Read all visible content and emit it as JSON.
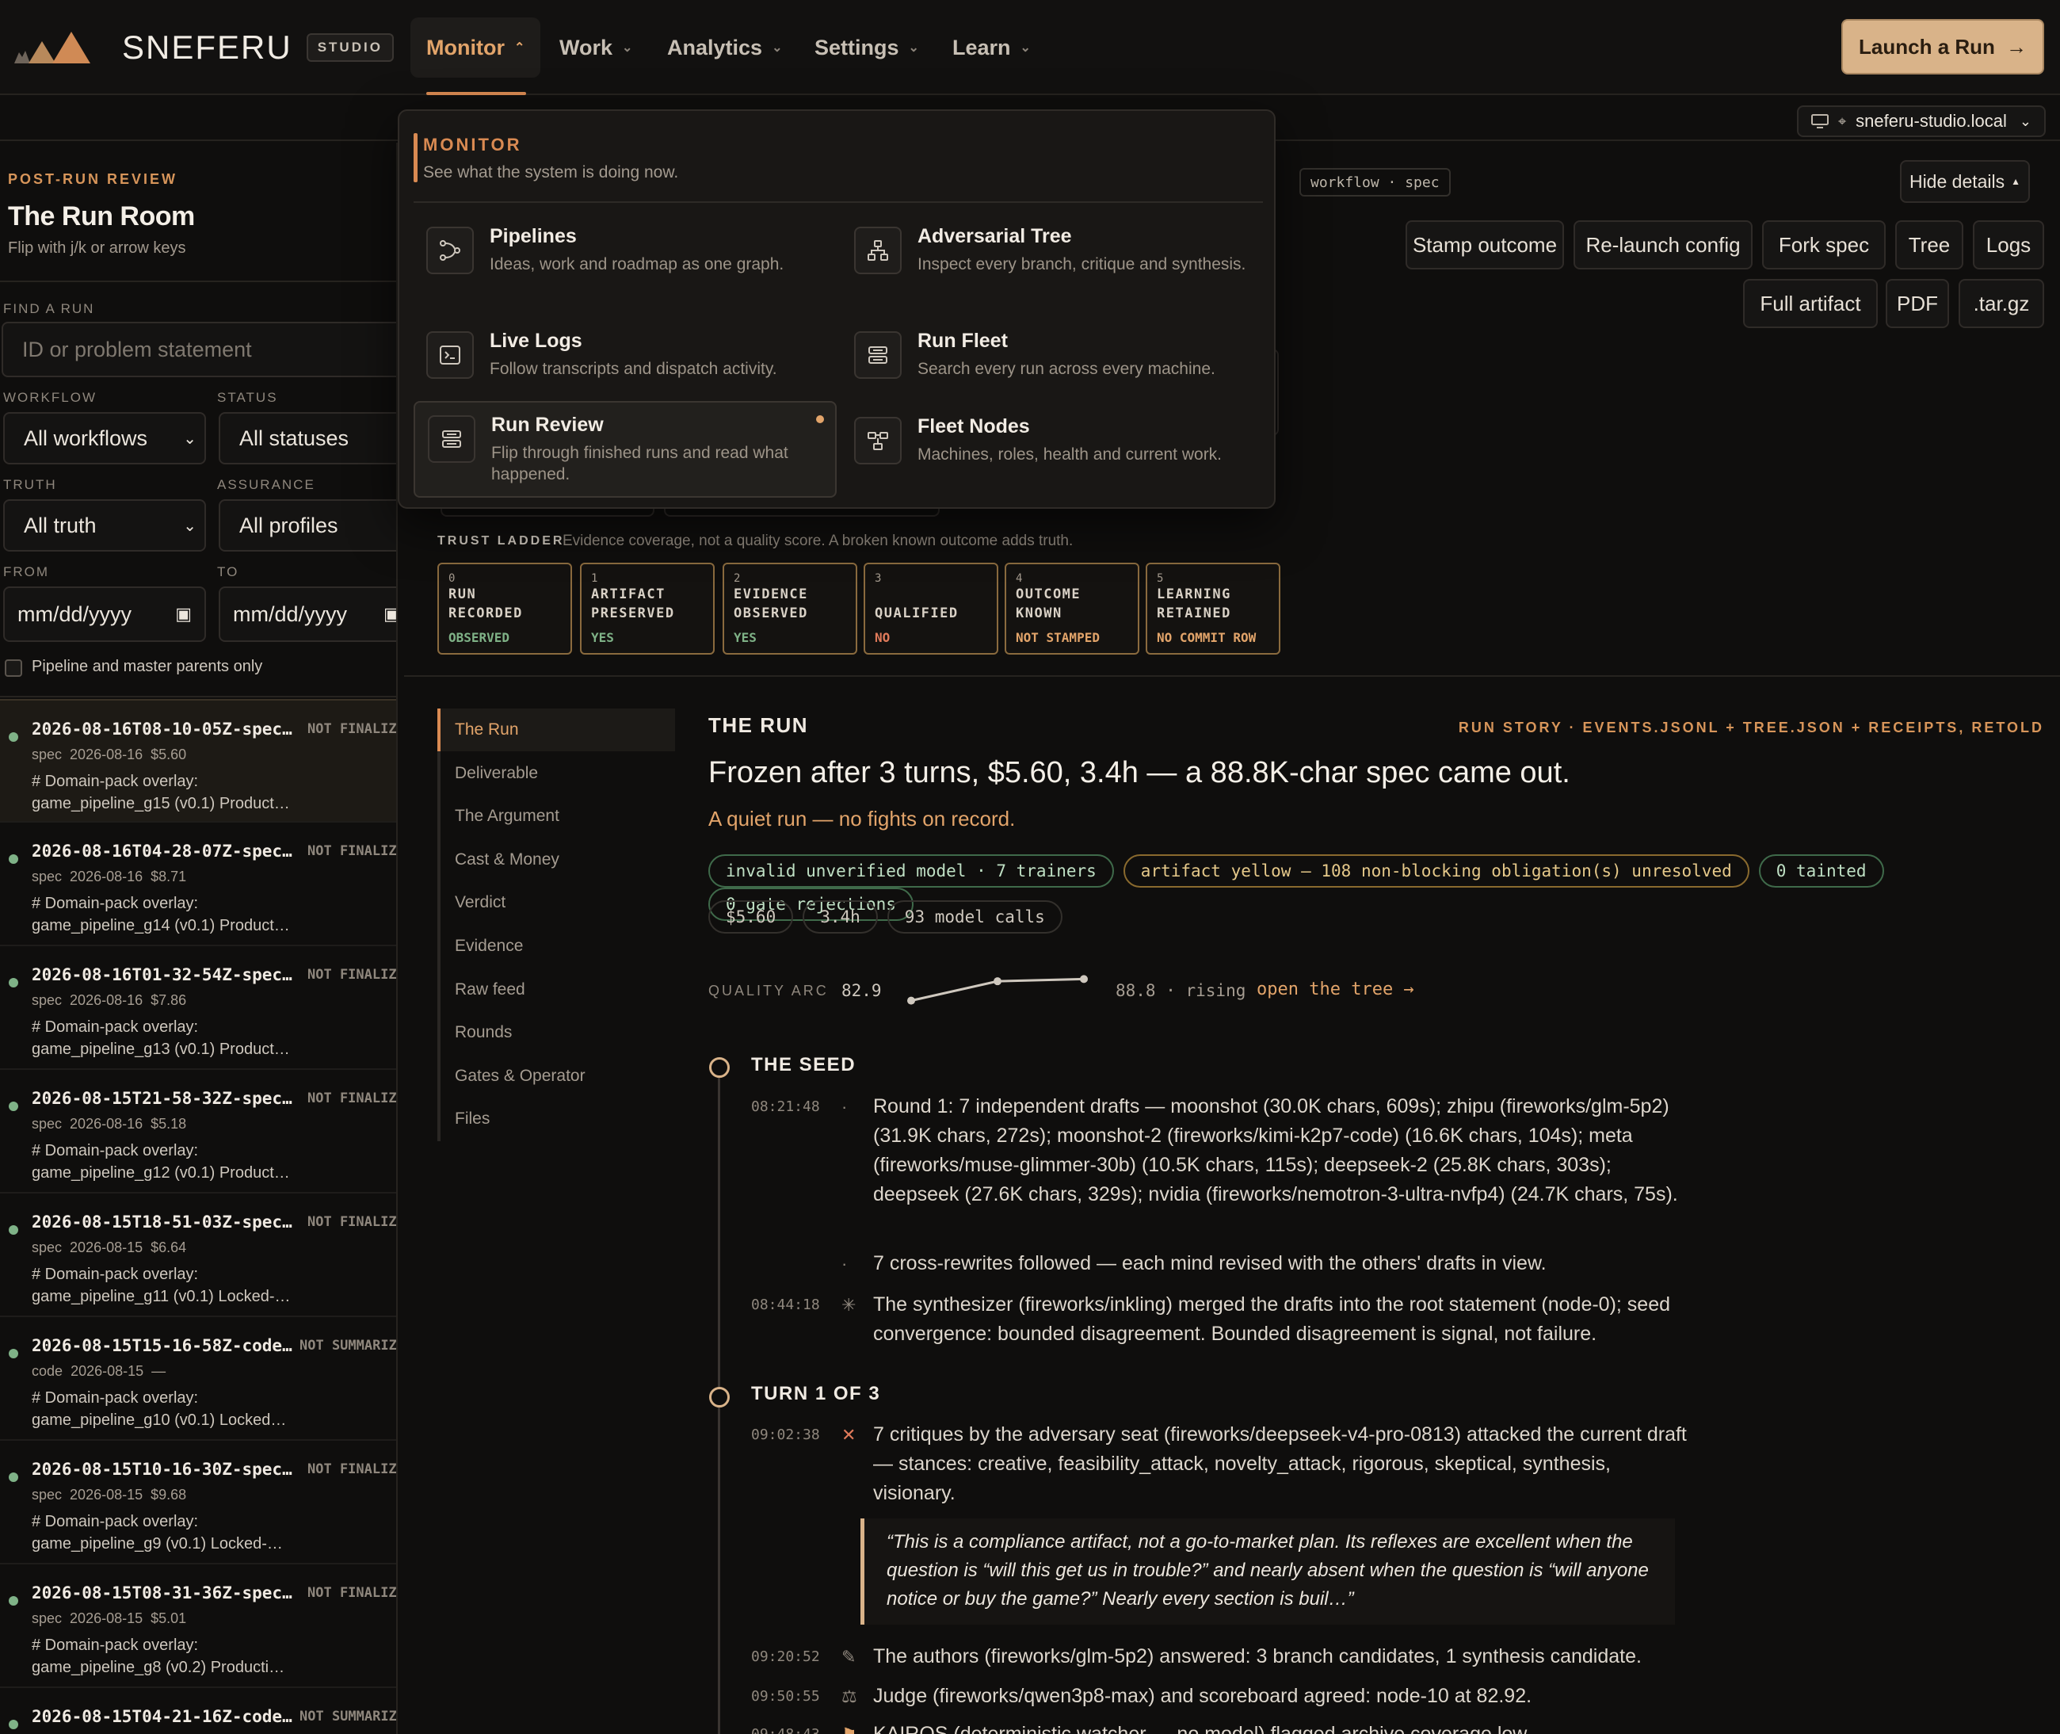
{
  "header": {
    "brand": "SNEFERU",
    "brand_badge": "STUDIO",
    "nav": [
      {
        "label": "Monitor"
      },
      {
        "label": "Work"
      },
      {
        "label": "Analytics"
      },
      {
        "label": "Settings"
      },
      {
        "label": "Learn"
      }
    ],
    "launch_label": "Launch a Run",
    "host": "sneferu-studio.local"
  },
  "sidebar": {
    "eyebrow": "POST-RUN REVIEW",
    "title": "The Run Room",
    "hint": "Flip with j/k or arrow keys",
    "find_label": "FIND A RUN",
    "find_placeholder": "ID or problem statement",
    "workflow_label": "WORKFLOW",
    "workflow_value": "All workflows",
    "status_label": "STATUS",
    "status_value": "All statuses",
    "truth_label": "TRUTH",
    "truth_value": "All truth",
    "assurance_label": "ASSURANCE",
    "assurance_value": "All profiles",
    "from_label": "FROM",
    "from_placeholder": "mm/dd/yyyy",
    "to_label": "TO",
    "to_placeholder": "mm/dd/yyyy",
    "parents_only": "Pipeline and master parents only",
    "runs": [
      {
        "title": "2026-08-16T08-10-05Z-spec-1…",
        "status": "NOT FINALIZ",
        "kind": "spec",
        "date": "2026-08-16",
        "cost": "$5.60",
        "overlay": "# Domain-pack overlay:",
        "overlay2": "game_pipeline_g15 (v0.1) Producti…"
      },
      {
        "title": "2026-08-16T04-28-07Z-spec-a…",
        "status": "NOT FINALIZ",
        "kind": "spec",
        "date": "2026-08-16",
        "cost": "$8.71",
        "overlay": "# Domain-pack overlay:",
        "overlay2": "game_pipeline_g14 (v0.1) Producti…"
      },
      {
        "title": "2026-08-16T01-32-54Z-spec-b…",
        "status": "NOT FINALIZ",
        "kind": "spec",
        "date": "2026-08-16",
        "cost": "$7.86",
        "overlay": "# Domain-pack overlay:",
        "overlay2": "game_pipeline_g13 (v0.1) Producti…"
      },
      {
        "title": "2026-08-15T21-58-32Z-spec-3…",
        "status": "NOT FINALIZ",
        "kind": "spec",
        "date": "2026-08-16",
        "cost": "$5.18",
        "overlay": "# Domain-pack overlay:",
        "overlay2": "game_pipeline_g12 (v0.1) Producti…"
      },
      {
        "title": "2026-08-15T18-51-03Z-spec-f…",
        "status": "NOT FINALIZ",
        "kind": "spec",
        "date": "2026-08-15",
        "cost": "$6.64",
        "overlay": "# Domain-pack overlay:",
        "overlay2": "game_pipeline_g11 (v0.1) Locked-…"
      },
      {
        "title": "2026-08-15T15-16-58Z-code-…",
        "status": "NOT SUMMARIZ",
        "kind": "code",
        "date": "2026-08-15",
        "cost": "—",
        "overlay": "# Domain-pack overlay:",
        "overlay2": "game_pipeline_g10 (v0.1) Locked…"
      },
      {
        "title": "2026-08-15T10-16-30Z-spec-4…",
        "status": "NOT FINALIZ",
        "kind": "spec",
        "date": "2026-08-15",
        "cost": "$9.68",
        "overlay": "# Domain-pack overlay:",
        "overlay2": "game_pipeline_g9 (v0.1) Locked-…"
      },
      {
        "title": "2026-08-15T08-31-36Z-spec-7…",
        "status": "NOT FINALIZ",
        "kind": "spec",
        "date": "2026-08-15",
        "cost": "$5.01",
        "overlay": "# Domain-pack overlay:",
        "overlay2": "game_pipeline_g8 (v0.2) Productio…"
      },
      {
        "title": "2026-08-15T04-21-16Z-code-…",
        "status": "NOT SUMMARIZ",
        "kind": "",
        "date": "",
        "cost": "",
        "overlay": "",
        "overlay2": ""
      }
    ]
  },
  "menu": {
    "eyebrow": "MONITOR",
    "subtitle": "See what the system is doing now.",
    "items": [
      {
        "title": "Pipelines",
        "desc": "Ideas, work and roadmap as one graph."
      },
      {
        "title": "Adversarial Tree",
        "desc": "Inspect every branch, critique and synthesis."
      },
      {
        "title": "Live Logs",
        "desc": "Follow transcripts and dispatch activity."
      },
      {
        "title": "Run Fleet",
        "desc": "Search every run across every machine."
      },
      {
        "title": "Run Review",
        "desc": "Flip through finished runs and read what happened."
      },
      {
        "title": "Fleet Nodes",
        "desc": "Machines, roles, health and current work."
      }
    ]
  },
  "toolbar": {
    "workflow_tag": "workflow · spec",
    "hide_details": "Hide details",
    "buttons": [
      "Stamp outcome",
      "Re-launch config",
      "Fork spec",
      "Tree",
      "Logs"
    ],
    "buttons2": [
      "Full artifact",
      "PDF",
      ".tar.gz"
    ]
  },
  "trust": {
    "label": "TRUST LADDER",
    "note": "Evidence coverage, not a quality score. A broken known outcome adds truth.",
    "rungs": [
      {
        "n": "0",
        "l1": "RUN",
        "l2": "RECORDED",
        "v": "OBSERVED",
        "c": "#7fb287"
      },
      {
        "n": "1",
        "l1": "ARTIFACT",
        "l2": "PRESERVED",
        "v": "YES",
        "c": "#7fb287"
      },
      {
        "n": "2",
        "l1": "EVIDENCE",
        "l2": "OBSERVED",
        "v": "YES",
        "c": "#7fb287"
      },
      {
        "n": "3",
        "l1": "QUALIFIED",
        "l2": "",
        "v": "NO",
        "c": "#e07a5a"
      },
      {
        "n": "4",
        "l1": "OUTCOME",
        "l2": "KNOWN",
        "v": "NOT STAMPED",
        "c": "#e2a46a"
      },
      {
        "n": "5",
        "l1": "LEARNING",
        "l2": "RETAINED",
        "v": "NO COMMIT ROW",
        "c": "#e2a46a"
      }
    ]
  },
  "tabs": [
    "The Run",
    "Deliverable",
    "The Argument",
    "Cast & Money",
    "Verdict",
    "Evidence",
    "Raw feed",
    "Rounds",
    "Gates & Operator",
    "Files"
  ],
  "run": {
    "section": "THE RUN",
    "source": "RUN STORY · EVENTS.JSONL + TREE.JSON + RECEIPTS, RETOLD",
    "headline": "Frozen after 3 turns, $5.60, 3.4h — a 88.8K-char spec came out.",
    "sub": "A quiet run — no fights on record.",
    "chips": [
      {
        "t": "invalid unverified model · 7 trainers",
        "accent": "green"
      },
      {
        "t": "artifact yellow — 108 non-blocking obligation(s) unresolved",
        "accent": "amber"
      },
      {
        "t": "0 tainted",
        "accent": "green"
      },
      {
        "t": "0 gate rejections",
        "accent": "green"
      }
    ],
    "chips2": [
      "$5.60",
      "3.4h",
      "93 model calls"
    ],
    "arc_label": "QUALITY ARC",
    "arc_start": "82.9",
    "arc_end": "88.8 · rising",
    "arc_link": "open the tree →",
    "arc_points": [
      82.9,
      88.2,
      88.8
    ],
    "seed_title": "THE SEED",
    "seed": [
      {
        "time": "08:21:48",
        "mark": "·",
        "text": "Round 1: 7 independent drafts — moonshot (30.0K chars, 609s); zhipu (fireworks/glm-5p2) (31.9K chars, 272s); moonshot-2 (fireworks/kimi-k2p7-code) (16.6K chars, 104s); meta (fireworks/muse-glimmer-30b) (10.5K chars, 115s); deepseek-2 (25.8K chars, 303s); deepseek (27.6K chars, 329s); nvidia (fireworks/nemotron-3-ultra-nvfp4) (24.7K chars, 75s)."
      },
      {
        "time": "",
        "mark": "·",
        "text": "7 cross-rewrites followed — each mind revised with the others' drafts in view."
      },
      {
        "time": "08:44:18",
        "mark": "✳",
        "text": "The synthesizer (fireworks/inkling) merged the drafts into the root statement (node-0); seed convergence: bounded disagreement. Bounded disagreement is signal, not failure."
      }
    ],
    "turn_title": "TURN 1 OF 3",
    "turn": [
      {
        "time": "09:02:38",
        "mark": "✕",
        "text": "7 critiques by the adversary seat (fireworks/deepseek-v4-pro-0813) attacked the current draft — stances: creative, feasibility_attack, novelty_attack, rigorous, skeptical, synthesis, visionary."
      }
    ],
    "quote": "“This is a compliance artifact, not a go-to-market plan. Its reflexes are excellent when the question is “will this get us in trouble?” and nearly absent when the question is “will anyone notice or buy the game?” Nearly every section is buil…”",
    "turn2": [
      {
        "time": "09:20:52",
        "mark": "✎",
        "text": "The authors (fireworks/glm-5p2) answered: 3 branch candidates, 1 synthesis candidate."
      },
      {
        "time": "09:50:55",
        "mark": "⚖",
        "text": "Judge (fireworks/qwen3p8-max) and scoreboard agreed: node-10 at 82.92."
      },
      {
        "time": "09:48:43",
        "mark": "⚑",
        "text": "KAIROS (deterministic watcher — no model) flagged archive coverage low →"
      }
    ]
  }
}
